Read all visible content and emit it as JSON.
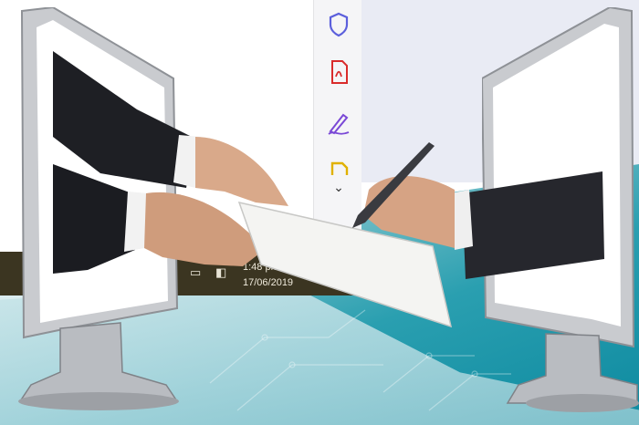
{
  "taskbar": {
    "time": "1:48 pm",
    "date": "17/06/2019",
    "icons": [
      "people-icon",
      "chevron-up-icon",
      "network-icon",
      "volume-icon"
    ]
  },
  "side_toolbar": {
    "icons": [
      "shield-icon",
      "pdf-icon",
      "signature-pen-icon",
      "document-icon",
      "chevron-down-icon"
    ],
    "colors": {
      "shield": "#5b5fdc",
      "pdf": "#d92b2b",
      "signature": "#7a48d6",
      "document": "#e0b100"
    }
  },
  "scene": {
    "left_monitor": "computer-monitor",
    "right_monitor": "computer-monitor",
    "document": "paper-sheet",
    "pen": "ballpoint-pen"
  }
}
